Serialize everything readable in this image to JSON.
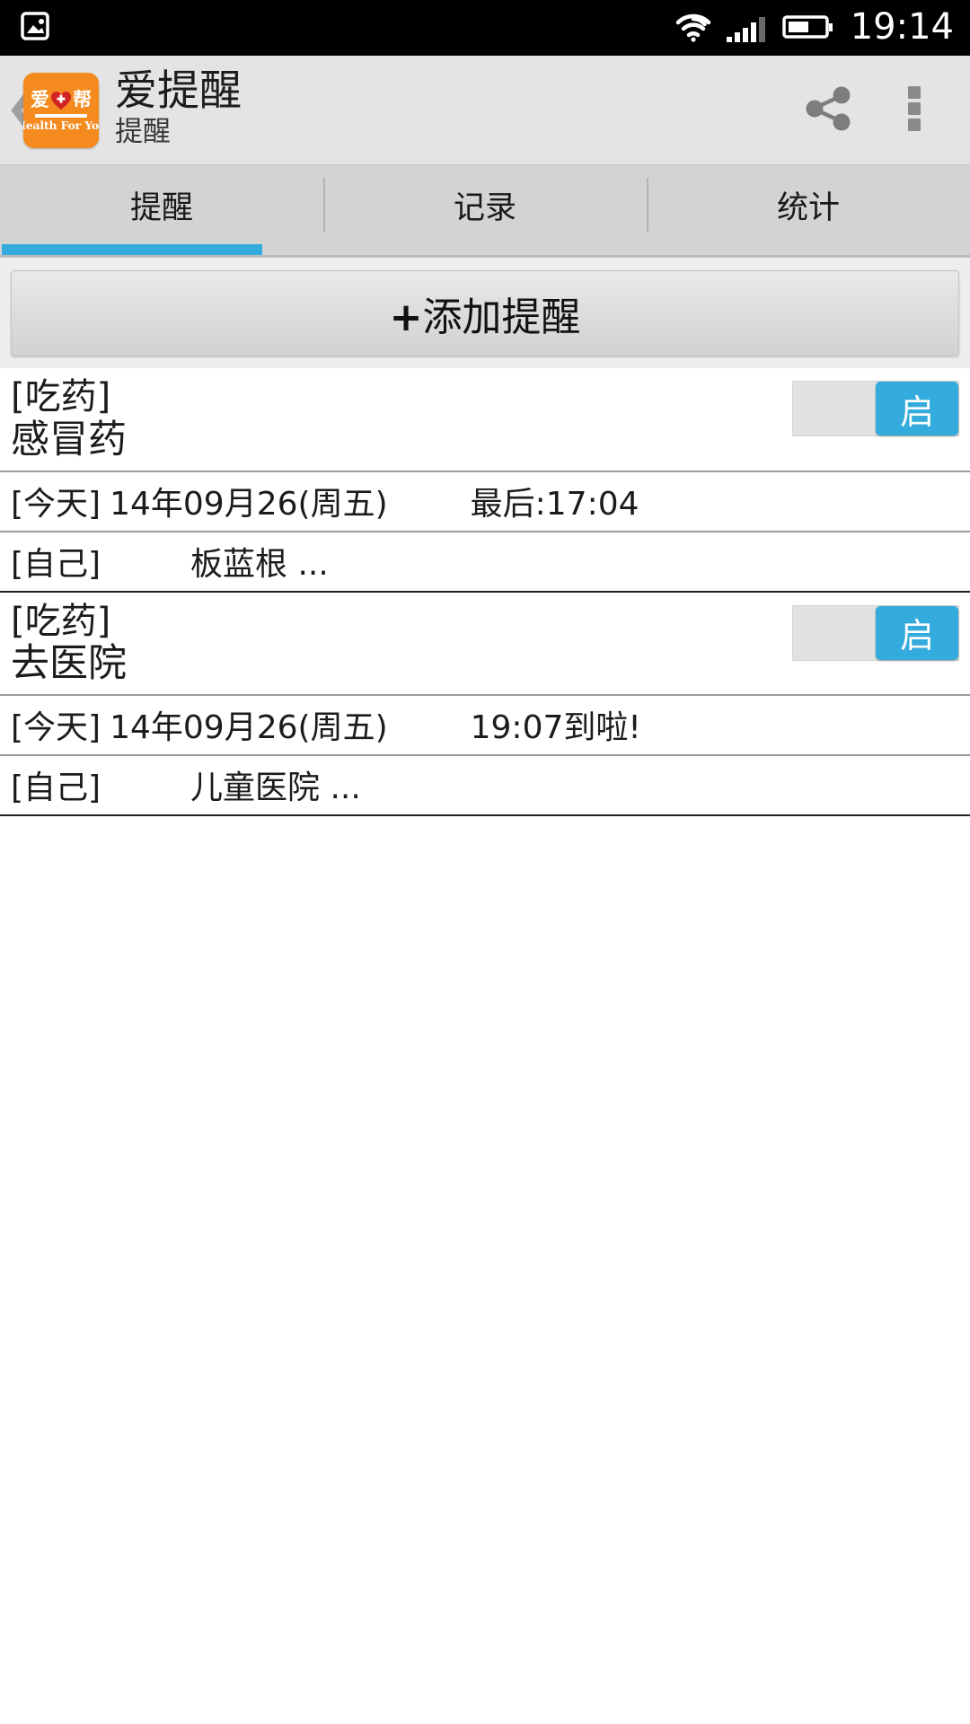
{
  "statusbar": {
    "notification_icon": "image-icon",
    "wifi_icon": "wifi-icon",
    "signal_icon": "signal-bars-icon",
    "battery_icon": "battery-icon",
    "clock": "19:14"
  },
  "actionbar": {
    "back_icon": "back-chevron-icon",
    "logo": {
      "name": "app-logo",
      "char_left": "爱",
      "heart_icon": "heart-cross-icon",
      "char_right": "帮",
      "subtitle": "Health For You",
      "color": "#f58a1f"
    },
    "title": "爱提醒",
    "subtitle": "提醒",
    "share_icon": "share-icon",
    "overflow_icon": "overflow-menu-icon"
  },
  "tabs": {
    "items": [
      {
        "label": "提醒",
        "active": true
      },
      {
        "label": "记录",
        "active": false
      },
      {
        "label": "统计",
        "active": false
      }
    ],
    "accent_color": "#33abdc"
  },
  "add_button": {
    "plus": "+",
    "label": "添加提醒"
  },
  "reminders": [
    {
      "tag": "[吃药]",
      "title": "感冒药",
      "toggle_label": "启",
      "toggle_on": true,
      "date_prefix": "[今天]",
      "date": "14年09月26(周五)",
      "status": "最后:17:04",
      "who": "[自己]",
      "note": "板蓝根 ..."
    },
    {
      "tag": "[吃药]",
      "title": "去医院",
      "toggle_label": "启",
      "toggle_on": true,
      "date_prefix": "[今天]",
      "date": "14年09月26(周五)",
      "status": "19:07到啦!",
      "who": "[自己]",
      "note": "儿童医院 ..."
    }
  ]
}
